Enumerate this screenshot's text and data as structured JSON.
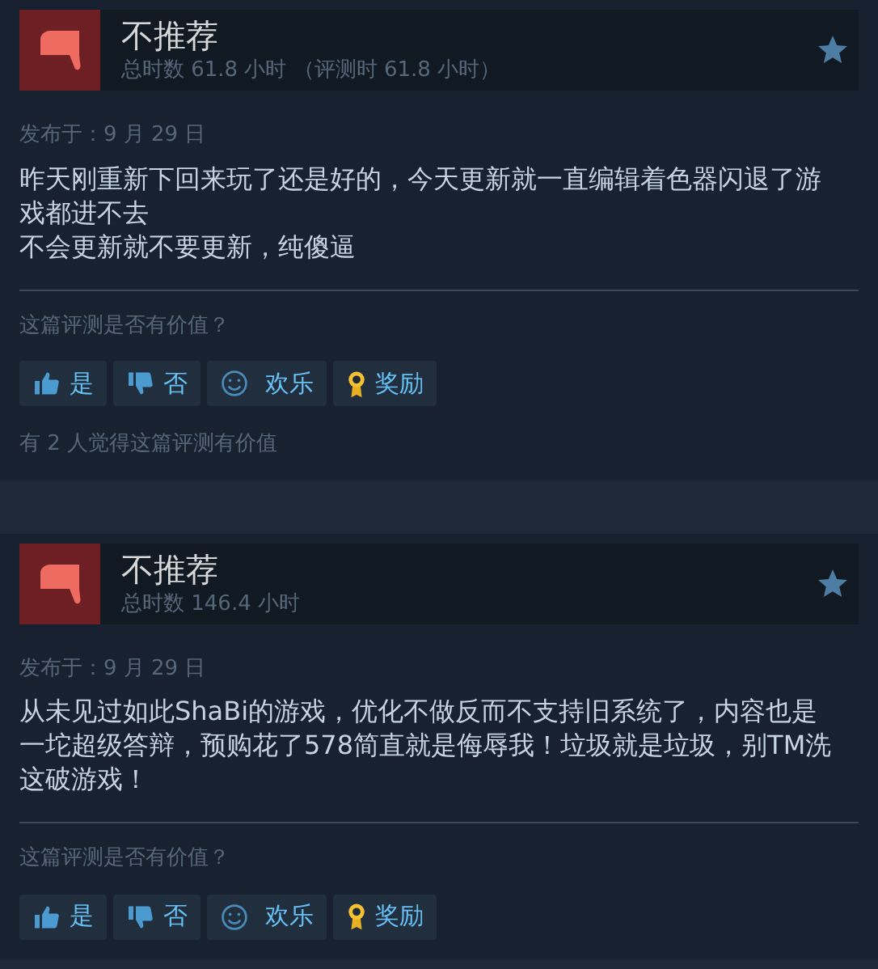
{
  "reviews": [
    {
      "verdict": "不推荐",
      "kind": "negative",
      "hours": "总时数 61.8 小时 （评测时 61.8 小时）",
      "posted": "发布于：9 月 29 日",
      "body": [
        "昨天刚重新下回来玩了还是好的，今天更新就一直编辑着色器闪退了游戏都进不去",
        "不会更新就不要更新，纯傻逼"
      ],
      "question": "这篇评测是否有价值？",
      "buttons": [
        {
          "label": "是",
          "kind": "yes"
        },
        {
          "label": "否",
          "kind": "no"
        },
        {
          "label": "欢乐",
          "kind": "funny"
        },
        {
          "label": "奖励",
          "kind": "award"
        }
      ],
      "helpful": "有 2 人觉得这篇评测有价值"
    },
    {
      "verdict": "不推荐",
      "kind": "negative",
      "hours": "总时数 146.4 小时",
      "posted": "发布于：9 月 29 日",
      "body": [
        "从未见过如此ShaBi的游戏，优化不做反而不支持旧系统了，内容也是一坨超级答辩，预购花了578简直就是侮辱我！垃圾就是垃圾，别TM洗这破游戏！"
      ],
      "question": "这篇评测是否有价值？",
      "buttons": [
        {
          "label": "是",
          "kind": "yes"
        },
        {
          "label": "否",
          "kind": "no"
        },
        {
          "label": "欢乐",
          "kind": "funny"
        },
        {
          "label": "奖励",
          "kind": "award"
        }
      ]
    }
  ]
}
